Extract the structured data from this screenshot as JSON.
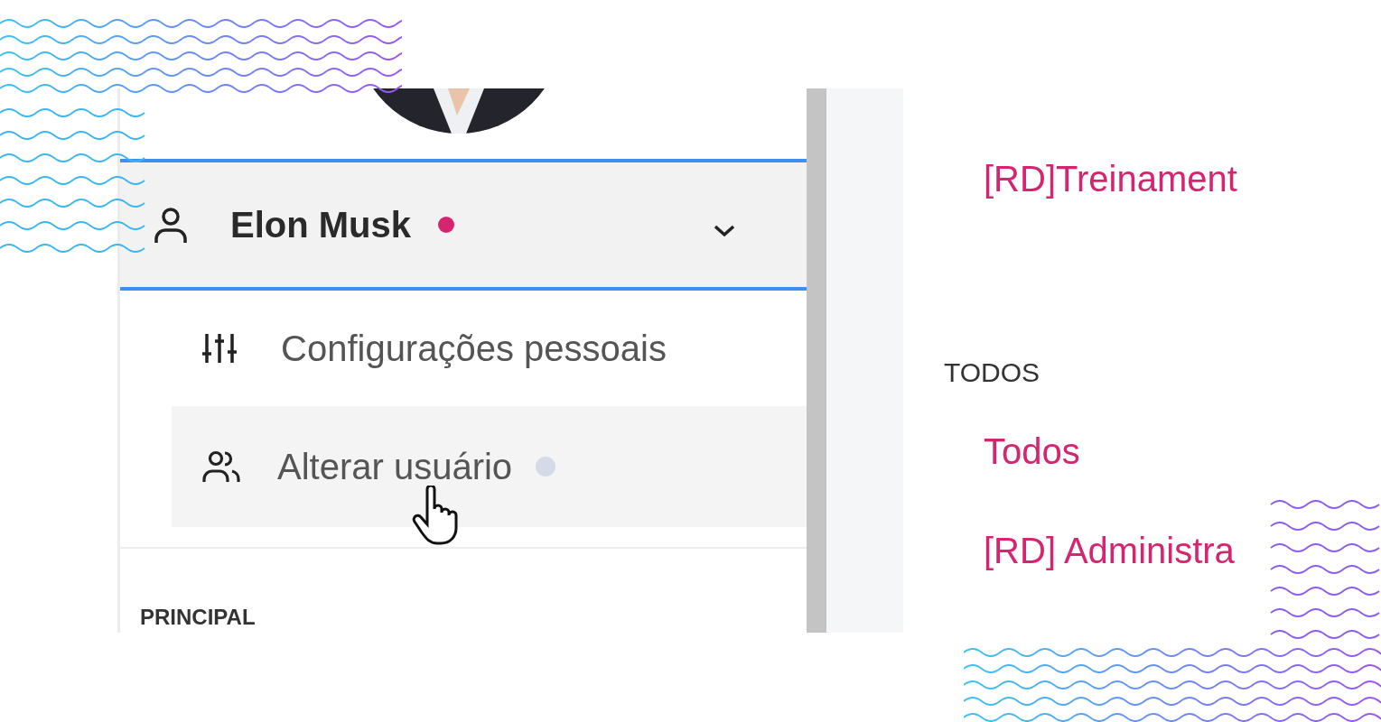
{
  "profile": {
    "name": "Elon Musk",
    "color": "#d6246e",
    "expanded": true
  },
  "menu": [
    {
      "kind": "settings",
      "label": "Configurações pessoais",
      "highlighted": false
    },
    {
      "kind": "switch-user",
      "label": "Alterar usuário",
      "highlighted": true,
      "color": "#d5dbe6"
    }
  ],
  "section_heading": "PRINCIPAL",
  "groups": [
    {
      "items": [
        "[RD]Treinament"
      ]
    },
    {
      "heading": "TODOS",
      "items": [
        "Todos",
        "[RD] Administra"
      ]
    }
  ]
}
